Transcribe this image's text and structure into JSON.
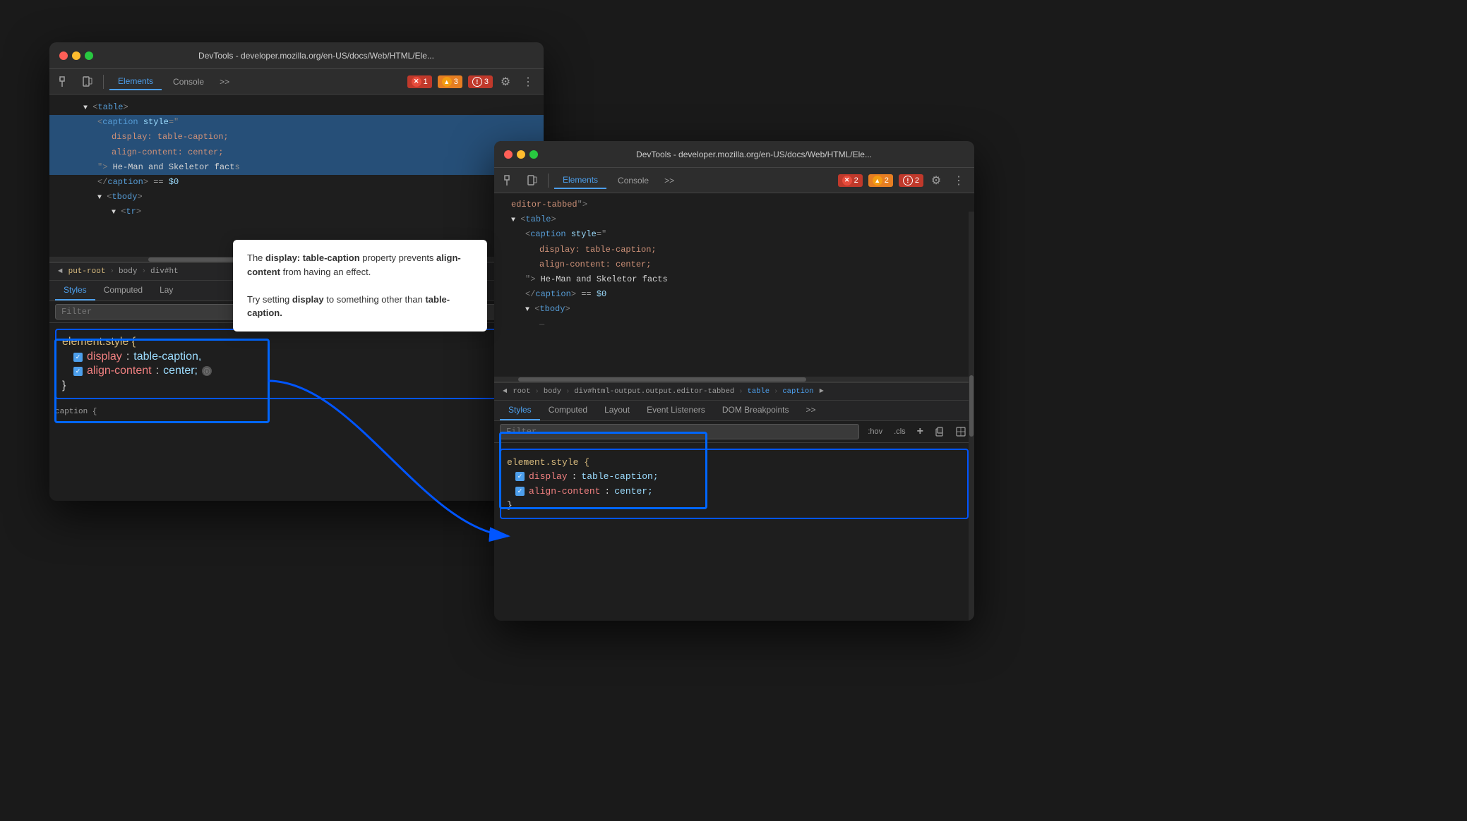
{
  "window1": {
    "title": "DevTools - developer.mozilla.org/en-US/docs/Web/HTML/Ele...",
    "tabs": {
      "elements": "Elements",
      "console": "Console",
      "more": ">>"
    },
    "badges": {
      "error": "1",
      "warning": "3",
      "info": "3"
    },
    "html_lines": [
      {
        "indent": 40,
        "content": "▼ <table>",
        "selected": false
      },
      {
        "indent": 60,
        "content": "<caption style=\"",
        "selected": true
      },
      {
        "indent": 80,
        "content": "display: table-caption;",
        "selected": true
      },
      {
        "indent": 80,
        "content": "align-content: center;",
        "selected": true
      },
      {
        "indent": 60,
        "content": "\"> He-Man and Skeletor fact",
        "selected": true
      },
      {
        "indent": 60,
        "content": "</caption> == $0",
        "selected": false
      },
      {
        "indent": 60,
        "content": "▼ <tbody>",
        "selected": false
      },
      {
        "indent": 80,
        "content": "▼ <tr>",
        "selected": false
      }
    ],
    "breadcrumbs": [
      "◄",
      "put-root",
      "body",
      "div#ht"
    ],
    "styles_tabs": [
      "Styles",
      "Computed",
      "Lay"
    ],
    "filter_placeholder": "Filter",
    "style_rule": {
      "selector": "element.style {",
      "properties": [
        {
          "name": "display",
          "value": "table-caption,",
          "checked": true
        },
        {
          "name": "align-content",
          "value": "center;",
          "checked": true,
          "has_info": true
        }
      ],
      "close": "}"
    }
  },
  "window2": {
    "title": "DevTools - developer.mozilla.org/en-US/docs/Web/HTML/Ele...",
    "tabs": {
      "elements": "Elements",
      "console": "Console",
      "more": ">>"
    },
    "badges": {
      "error": "2",
      "warning": "2",
      "info": "2"
    },
    "html_lines": [
      {
        "content": "editor-tabbed\">",
        "indent": 0
      },
      {
        "content": "▼ <table>",
        "indent": 0
      },
      {
        "content": "<caption style=\"",
        "indent": 1
      },
      {
        "content": "display: table-caption;",
        "indent": 2
      },
      {
        "content": "align-content: center;",
        "indent": 2
      },
      {
        "content": "\"> He-Man and Skeletor facts",
        "indent": 1
      },
      {
        "content": "</caption> == $0",
        "indent": 1
      },
      {
        "content": "▼ <tbody>",
        "indent": 1
      },
      {
        "content": "—",
        "indent": 2
      }
    ],
    "breadcrumbs": [
      "◄",
      "root",
      "body",
      "div#html-output.output.editor-tabbed",
      "table",
      "caption",
      "►"
    ],
    "styles_tabs": [
      "Styles",
      "Computed",
      "Layout",
      "Event Listeners",
      "DOM Breakpoints",
      ">>"
    ],
    "filter_placeholder": "Filter",
    "styles_toolbar_items": [
      ":hov",
      ".cls",
      "+"
    ],
    "style_rule": {
      "selector": "element.style {",
      "properties": [
        {
          "name": "display",
          "value": "table-caption;",
          "checked": true
        },
        {
          "name": "align-content",
          "value": "center;",
          "checked": true
        }
      ],
      "close": "}"
    }
  },
  "tooltip": {
    "text_parts": [
      {
        "text": "The "
      },
      {
        "text": "display: table-caption",
        "bold": true
      },
      {
        "text": " property prevents "
      },
      {
        "text": "align-content",
        "bold": true
      },
      {
        "text": " from having an effect."
      },
      {
        "text": "\n\nTry setting "
      },
      {
        "text": "display",
        "bold": true
      },
      {
        "text": " to something other than "
      },
      {
        "text": "table-caption.",
        "bold": true
      }
    ],
    "line1": "The display: table-caption property",
    "line2": "prevents align-content from having an",
    "line3": "effect.",
    "line4": "",
    "line5": "Try setting display to something other than",
    "line6": "table-caption."
  },
  "icons": {
    "inspect": "⬚",
    "device": "📱",
    "gear": "⚙",
    "more_vert": "⋮",
    "arrow_left": "◄",
    "arrow_right": "►",
    "chevron_more": ">>"
  }
}
